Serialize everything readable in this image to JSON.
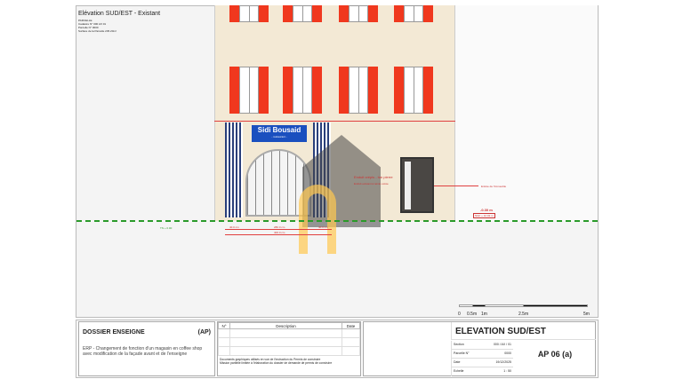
{
  "header": {
    "title": "Elévation SUD/EST - Existant",
    "info": [
      "PARCELLE",
      "Cadastre N° 000 AX 01",
      "Parcelle N° 0000",
      "Surface de la Parcelle 245.20m²"
    ]
  },
  "sign": {
    "name": "Sidi Bousaid",
    "sub": "- restaurant -"
  },
  "annotations": {
    "wall": "Enduit crépis - ton pierre",
    "wall_sub": "Enduit existant à teinte ocrée",
    "door": "Entrée de l'immeuble",
    "level": "-0.30 m",
    "ngf": "NGF + 12.02 m",
    "ground": "TN + 0.00",
    "dims": [
      "40.0 cm",
      "280.0 cm",
      "40.0 cm",
      "400.0 cm"
    ]
  },
  "scale": {
    "labels": [
      "0",
      "0.5m",
      "1m",
      "2.5m",
      "5m"
    ]
  },
  "title_block": {
    "project": "DOSSIER ENSEIGNE",
    "type": "(AP)",
    "description": "ERP - Changement de fonction d'un magasin en coffee shop avec modification de la façade avant et de l'enseigne",
    "rev_headers": [
      "N°",
      "Description",
      "Date"
    ],
    "notes": [
      "Documents graphiques utilisés en vue de l'instruction du Permis de construire",
      "Mission partielle limitée à l'élaboration du dossier de demande de permis de construire"
    ],
    "sheet_title": "ELEVATION SUD/EST",
    "fields": [
      {
        "k": "Section",
        "v": "000 / AX / 01"
      },
      {
        "k": "Parcelle N°",
        "v": "0000"
      },
      {
        "k": "Date",
        "v": "19/12/2025"
      },
      {
        "k": "Echelle",
        "v": "1 : 50"
      }
    ],
    "sheet_no": "AP 06 (a)"
  },
  "colors": {
    "shutter": "#f0381e",
    "sign": "#1a4fbf",
    "ground": "#2a9a2a"
  }
}
